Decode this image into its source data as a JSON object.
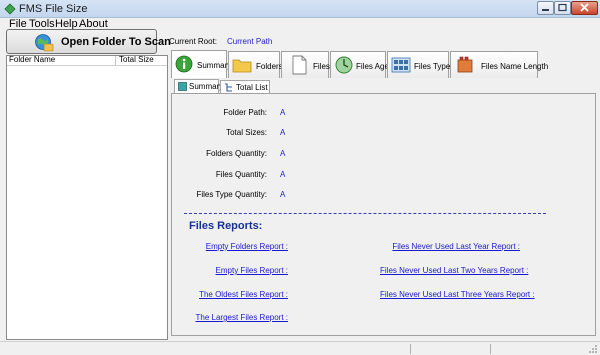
{
  "window": {
    "title": "FMS File Size"
  },
  "menu": [
    "File",
    "Tools",
    "Help",
    "About"
  ],
  "scan_button": {
    "label": "Open Folder To Scan",
    "icon": "globe-scan-icon"
  },
  "folder_list": {
    "columns": [
      "Folder Name",
      "Total Size"
    ]
  },
  "current_root": {
    "label": "Current Root:",
    "value": "Current Path"
  },
  "tabs": [
    {
      "label": "Summary",
      "icon": "info-icon",
      "active": true
    },
    {
      "label": "Folders",
      "icon": "folder-icon"
    },
    {
      "label": "Files",
      "icon": "file-icon"
    },
    {
      "label": "Files Age",
      "icon": "clock-icon"
    },
    {
      "label": "Files Type",
      "icon": "grid-icon"
    },
    {
      "label": "Files Name Length",
      "icon": "ruler-icon"
    }
  ],
  "subtabs": [
    {
      "label": "Summary",
      "active": true
    },
    {
      "label": "Total List"
    }
  ],
  "summary_fields": [
    {
      "label": "Folder Path:",
      "value": "A"
    },
    {
      "label": "Total Sizes:",
      "value": "A"
    },
    {
      "label": "Folders Quantity:",
      "value": "A"
    },
    {
      "label": "Files Quantity:",
      "value": "A"
    },
    {
      "label": "Files Type Quantity:",
      "value": "A"
    }
  ],
  "reports": {
    "title": "Files Reports:",
    "left": [
      "Empty Folders Report :",
      "Empty Files Report :",
      "The Oldest Files Report :",
      "The Largest Files Report :"
    ],
    "right": [
      "Files Never Used Last Year Report :",
      "Files Never Used Last Two Years Report :",
      "Files Never Used Last Three Years Report :"
    ]
  },
  "colors": {
    "link": "#1a1ad0",
    "value": "#2323c8",
    "reports_title": "#17309a"
  }
}
